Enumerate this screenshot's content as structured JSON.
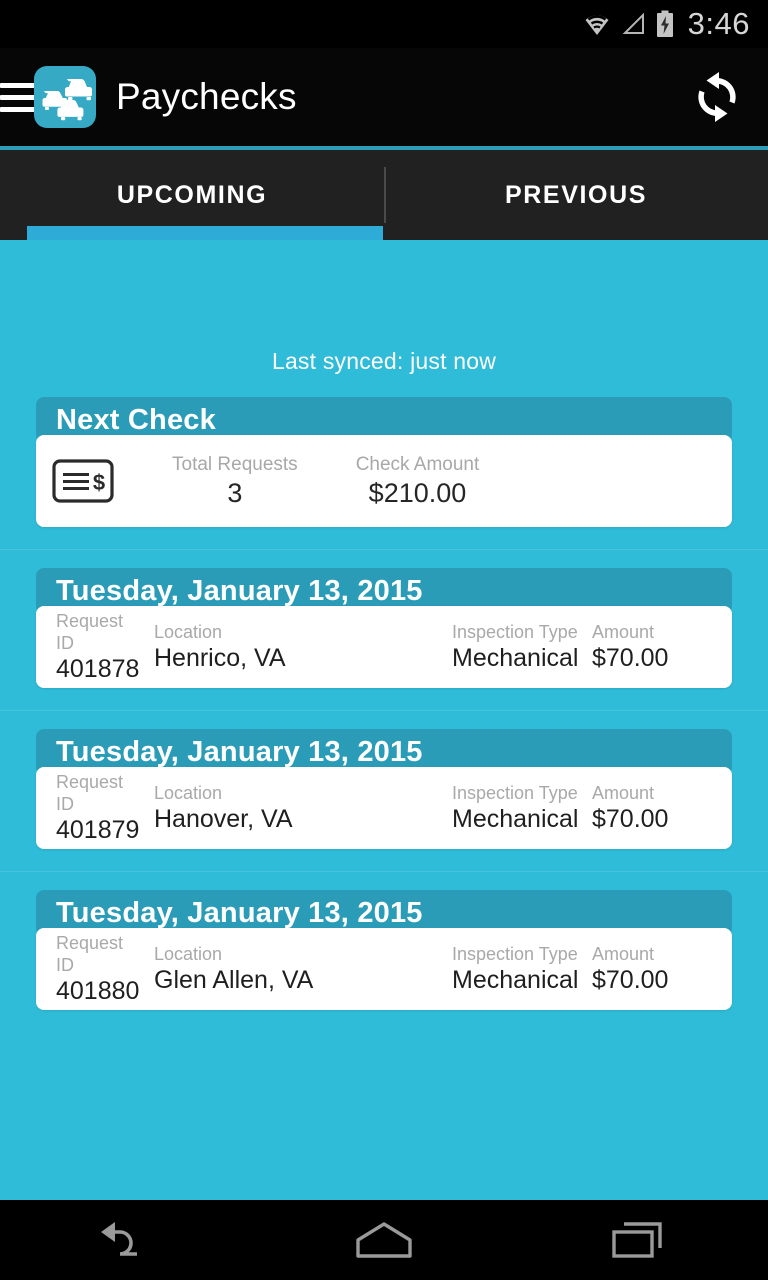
{
  "status_bar": {
    "time": "3:46",
    "icons": [
      "wifi-icon",
      "cell-signal-icon",
      "battery-charging-icon"
    ]
  },
  "app_bar": {
    "title": "Paychecks",
    "menu_icon": "hamburger-menu-icon",
    "app_logo": "cars-traffic-app-icon",
    "sync_icon": "sync-refresh-icon"
  },
  "tabs": [
    {
      "label": "UPCOMING",
      "active": true
    },
    {
      "label": "PREVIOUS",
      "active": false
    }
  ],
  "content": {
    "sync_status": "Last synced: just now",
    "next_check": {
      "header": "Next Check",
      "icon": "check-dollar-icon",
      "fields": [
        {
          "label": "Total Requests",
          "value": "3"
        },
        {
          "label": "Check Amount",
          "value": "$210.00"
        }
      ]
    },
    "field_labels": {
      "request_id": "Request ID",
      "location": "Location",
      "inspection_type": "Inspection Type",
      "amount": "Amount"
    },
    "requests": [
      {
        "date": "Tuesday, January 13, 2015",
        "request_id": "401878",
        "location": "Henrico, VA",
        "inspection_type": "Mechanical",
        "amount": "$70.00"
      },
      {
        "date": "Tuesday, January 13, 2015",
        "request_id": "401879",
        "location": "Hanover, VA",
        "inspection_type": "Mechanical",
        "amount": "$70.00"
      },
      {
        "date": "Tuesday, January 13, 2015",
        "request_id": "401880",
        "location": "Glen Allen, VA",
        "inspection_type": "Mechanical",
        "amount": "$70.00"
      }
    ]
  },
  "nav_bar": {
    "back": "back-icon",
    "home": "home-icon",
    "recents": "recent-apps-icon"
  },
  "colors": {
    "background_teal": "#2fbcd8",
    "header_teal": "#2b9cb8",
    "tab_indicator": "#2fabd8",
    "app_bar_black": "#060606",
    "tab_bar_dark": "#212121",
    "card_white": "#ffffff"
  }
}
